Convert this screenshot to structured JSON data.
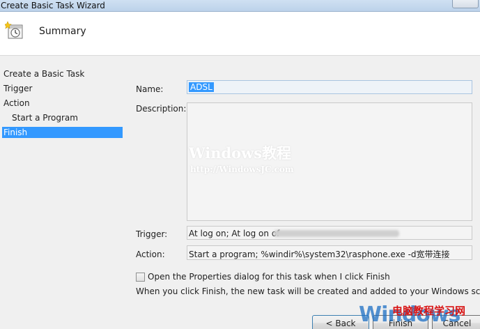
{
  "window": {
    "title": "Create Basic Task Wizard"
  },
  "header": {
    "title": "Summary",
    "icon": "task-clock-icon"
  },
  "steps": [
    {
      "label": "Create a Basic Task",
      "active": false
    },
    {
      "label": "Trigger",
      "active": false
    },
    {
      "label": "Action",
      "active": false
    },
    {
      "label": "Start a Program",
      "active": false,
      "sub": true
    },
    {
      "label": "Finish",
      "active": true
    }
  ],
  "form": {
    "name_label": "Name:",
    "name_value": "ADSL",
    "description_label": "Description:",
    "description_value": "",
    "trigger_label": "Trigger:",
    "trigger_value": "At log on; At log on of",
    "action_label": "Action:",
    "action_value": "Start a program; %windir%\\system32\\rasphone.exe -d宽带连接",
    "checkbox_label": "Open the Properties dialog for this task when I click Finish",
    "checkbox_checked": false,
    "note": "When you click Finish, the new task will be created and added to your Windows schedule."
  },
  "buttons": {
    "back": "< Back",
    "finish": "Finish",
    "cancel": "Cancel"
  },
  "watermarks": {
    "center_title": "Windows教程",
    "center_url": "http://WindowsJC.com",
    "corner_en": "Windows",
    "corner_cn": "电脑教程学习网"
  },
  "colors": {
    "selection": "#3399ff",
    "content_bg": "#f0f0f0",
    "titlebar": "#c4d7ed"
  }
}
